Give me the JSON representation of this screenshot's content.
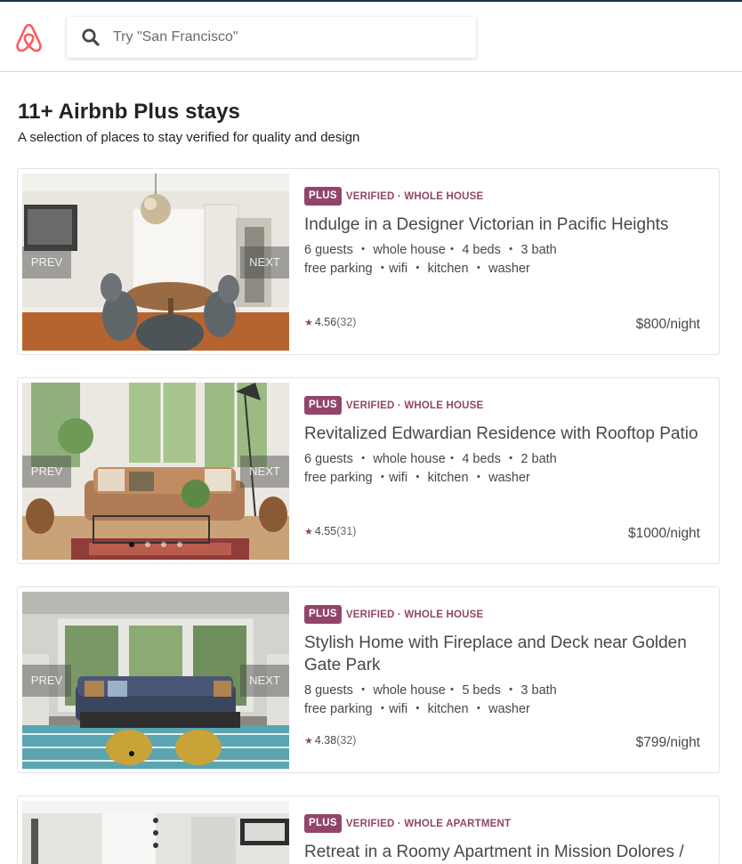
{
  "header": {
    "search_placeholder": "Try \"San Francisco\""
  },
  "page": {
    "title": "11+ Airbnb Plus stays",
    "subtitle": "A selection of places to stay verified for quality and design"
  },
  "photo_nav": {
    "prev": "PREV",
    "next": "NEXT"
  },
  "listings": [
    {
      "badge": "PLUS",
      "verified": "VERIFIED · WHOLE HOUSE",
      "title": "Indulge in a Designer Victorian in Pacific Heights",
      "details_1": "6 guests ・ whole house・ 4 beds ・ 3 bath",
      "details_2": "free parking ・wifi ・ kitchen ・ washer",
      "rating": "4.56",
      "reviews": "(32)",
      "price": "$800/night"
    },
    {
      "badge": "PLUS",
      "verified": "VERIFIED · WHOLE HOUSE",
      "title": "Revitalized Edwardian Residence with Rooftop Patio",
      "details_1": "6 guests ・ whole house・ 4 beds ・ 2 bath",
      "details_2": "free parking ・wifi ・ kitchen ・ washer",
      "rating": "4.55",
      "reviews": "(31)",
      "price": "$1000/night"
    },
    {
      "badge": "PLUS",
      "verified": "VERIFIED · WHOLE HOUSE",
      "title": "Stylish Home with Fireplace and Deck near Golden Gate Park",
      "details_1": "8 guests ・ whole house・ 5 beds ・ 3 bath",
      "details_2": "free parking ・wifi ・ kitchen ・ washer",
      "rating": "4.38",
      "reviews": "(32)",
      "price": "$799/night"
    },
    {
      "badge": "PLUS",
      "verified": "VERIFIED · WHOLE APARTMENT",
      "title": "Retreat in a Roomy Apartment in Mission Dolores /"
    }
  ],
  "colors": {
    "brand": "#ff5a5f",
    "plus": "#914669",
    "text": "#484848"
  },
  "icons": {
    "logo": "airbnb-logo",
    "search": "search-icon",
    "rating": "star-icon"
  }
}
